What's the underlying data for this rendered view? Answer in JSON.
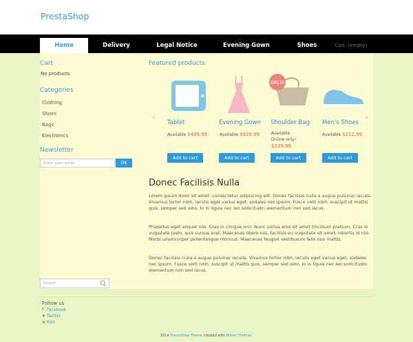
{
  "header": {
    "logo": "PrestaShop"
  },
  "nav": {
    "items": [
      {
        "label": "Home"
      },
      {
        "label": "Delivery"
      },
      {
        "label": "Legal Notice"
      },
      {
        "label": "Evening Gown"
      },
      {
        "label": "Shoes"
      }
    ],
    "cart": "Cart: (empty)"
  },
  "sidebar": {
    "cart_title": "Cart",
    "cart_text": "No products",
    "categories_title": "Categories",
    "categories": [
      "Clothing",
      "Shoes",
      "Bags",
      "Electronics"
    ],
    "newsletter_title": "Newsletter",
    "email_placeholder": "Enter your email",
    "ok_label": "OK",
    "search_placeholder": "Search"
  },
  "featured": {
    "title": "Featured products",
    "products": [
      {
        "name": "Tablet",
        "line1": "Available",
        "price": "$499.99",
        "add": "Add to cart"
      },
      {
        "name": "Evening Gown",
        "line1": "Available",
        "price": "$929.99",
        "add": "Add to cart"
      },
      {
        "name": "Shoulder Bag",
        "line1": "Available",
        "line2": "Online only!",
        "price": "$339.99",
        "badge": "SALE!",
        "add": "Add to cart"
      },
      {
        "name": "Men's Shoes",
        "line1": "Available",
        "price": "$212.99",
        "add": "Add to cart"
      }
    ]
  },
  "article": {
    "title": "Donec Facilisis Nulla",
    "paragraphs": [
      "Lorem ipsum dolor sit amet, consectetur adipiscing elit.  Donec facilisis nulla a augue pulvinar iaculis. Vivamus tortor nibh, iaculis eget varius eget, sodales nec ipsum. Fusce velit nibh, suscipit ut mattis quis, semper sed odio. In in ligula nec leo sollicitudin elementum non sed lacus.",
      "Phasellus eget aliquet nisi. Cras in congue orci. Nunc varius eros sit amet tincidunt pretium. Cras in vulputate justo, quis cursus erat. Maecenas libero nisi, facilisis eu vulputate sit amet, lobortis id nisl. Morbi ullamcorper pellentesque rhoncus. Maecenas feugiat vestibulum felis non mattis.",
      "Donec facilisis nulla a augue pulvinar iaculis. Vivamus tortor nibh, iaculis eget varius eget, sodales nec ipsum. Fusce velit nibh, suscipit ut mattis quis, semper sed odio. In in ligula nec leo sollicitudin elementum non sed lacus."
    ]
  },
  "footer": {
    "follow_title": "Follow us",
    "facebook": "Facebook",
    "twitter": "Twitter",
    "rss": "RSS",
    "year": "2014",
    "theme_link": "PrestaShop Theme",
    "created_with": "created with",
    "themler_link": "Billion Themler."
  },
  "colors": {
    "accent": "#3b9ad9",
    "nav_bg": "#000000",
    "page_bg": "#eaf5c5",
    "content_bg": "#fdfbd2",
    "price": "#e25b56"
  }
}
